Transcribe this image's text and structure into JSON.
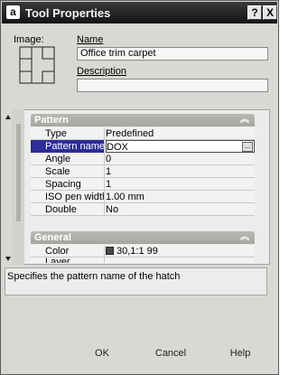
{
  "window": {
    "app_icon": "a",
    "title": "Tool Properties",
    "help_btn": "?",
    "close_btn": "X"
  },
  "image_label": "Image:",
  "name": {
    "label": "Name",
    "value": "Office trim carpet"
  },
  "description": {
    "label": "Description",
    "value": ""
  },
  "pattern": {
    "header": "Pattern",
    "rows": [
      {
        "key": "Type",
        "value": "Predefined"
      },
      {
        "key": "Pattern name",
        "value": "DOX"
      },
      {
        "key": "Angle",
        "value": "0"
      },
      {
        "key": "Scale",
        "value": "1"
      },
      {
        "key": "Spacing",
        "value": "1"
      },
      {
        "key": "ISO pen width",
        "value": "1.00 mm"
      },
      {
        "key": "Double",
        "value": "No"
      }
    ],
    "ellipsis": "..."
  },
  "general": {
    "header": "General",
    "color": {
      "key": "Color",
      "value": "30,1:1 99",
      "swatch": "#4a4a4a"
    },
    "layer": {
      "key": "Layer",
      "value": ""
    }
  },
  "help_text": "Specifies the pattern name of the hatch",
  "buttons": {
    "ok": "OK",
    "cancel": "Cancel",
    "help": "Help"
  },
  "icons": {
    "collapse": "chevron-up-icon",
    "scroll_up": "triangle-up-icon",
    "scroll_down": "triangle-down-icon"
  },
  "colors": {
    "titlebar": "#1e1e1e",
    "selection": "#2c2c9a",
    "section_header": "#b0b0ac"
  }
}
